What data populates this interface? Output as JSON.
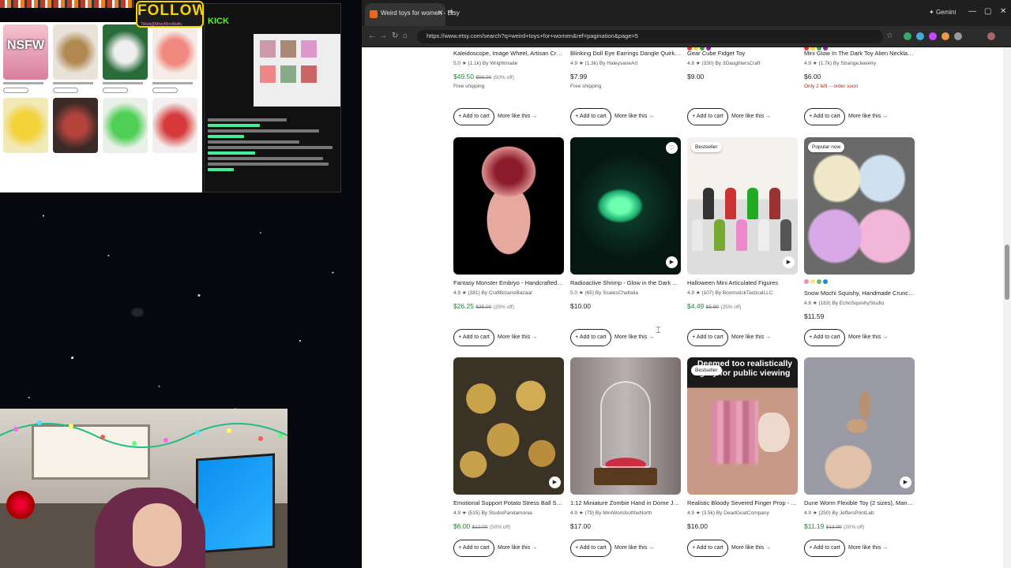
{
  "stream": {
    "follow_label": "FOLLOW",
    "follow_sub": "Tiktok@MitzyMonWaifu",
    "kick_label": "KICK",
    "nsfw_label": "NSFW"
  },
  "browser": {
    "tab_title": "Weird toys for women - Etsy",
    "gemini_label": "Gemini",
    "url": "https://www.etsy.com/search?q=weird+toys+for+women&ref=pagination&page=5"
  },
  "common": {
    "add_to_cart": "+ Add to cart",
    "more_like_this": "More like this →"
  },
  "row0": [
    {
      "title": "Kaleidoscope, Image Wheel, Artisan Crafted i...",
      "rating": "5.0 ★ (1.1k) By Wrightmade",
      "price": "$49.50",
      "orig": "$99.00",
      "pct": "(50% off)",
      "note": "Free shipping",
      "sale": true
    },
    {
      "title": "Blinking Doll Eye Earrings Dangle Quirky Weird...",
      "rating": "4.9 ★ (1.3k) By HaleysaneArt",
      "price": "$7.99",
      "orig": "",
      "pct": "",
      "note": "Free shipping",
      "sale": false
    },
    {
      "title": "Gear Cube Fidget Toy",
      "rating": "4.8 ★ (330) By 3DaughtersCraft",
      "price": "$9.00",
      "orig": "",
      "pct": "",
      "note": "",
      "sale": false
    },
    {
      "title": "Mini Glow In The Dark Toy Alien Necklaces",
      "rating": "4.9 ★ (1.7k) By StrangeJewelry",
      "price": "$6.00",
      "orig": "",
      "pct": "",
      "note": "Only 2 left -- order soon",
      "sale": false
    }
  ],
  "row1": [
    {
      "title": "Fantasy Monster Embryo - Handcrafted Clay S...",
      "rating": "4.9 ★ (381) By CraftBizarreBazaar",
      "price": "$26.25",
      "orig": "$35.00",
      "pct": "(25% off)",
      "badge": "",
      "sale": true
    },
    {
      "title": "Radioactive Shrimp - Glow in the Dark Articula...",
      "rating": "5.0 ★ (65) By ScalesChaltalia",
      "price": "$10.00",
      "orig": "",
      "pct": "",
      "badge": "",
      "sale": false
    },
    {
      "title": "Halloween Mini Articulated Figures",
      "rating": "4.9 ★ (107) By BoomstickTacticalLLC",
      "price": "$4.49",
      "orig": "$5.99",
      "pct": "(25% off)",
      "badge": "Bestseller",
      "sale": true
    },
    {
      "title": "Snow Mochi Squishy, Handmade Crunchy San...",
      "rating": "4.8 ★ (163) By EchoSquishyStudio",
      "price": "$11.59",
      "orig": "",
      "pct": "",
      "badge": "Popular now",
      "sale": false
    }
  ],
  "row2": [
    {
      "title": "Emotional Support Potato Stress Ball Squishy ...",
      "rating": "4.9 ★ (515) By StudioPandamonia",
      "price": "$6.00",
      "orig": "$12.00",
      "pct": "(50% off)",
      "badge": "",
      "sale": true
    },
    {
      "title": "1:12 Miniature Zombie Hand in Dome Jar- diora...",
      "rating": "4.9 ★ (79) By MiniWorldsoftheNorth",
      "price": "$17.00",
      "orig": "",
      "pct": "",
      "badge": "",
      "sale": false
    },
    {
      "title": "Realistic Bloody Severed Finger Prop - Hallow...",
      "rating": "4.9 ★ (3.5k) By DeadGoatCompany",
      "price": "$16.00",
      "orig": "",
      "pct": "",
      "badge": "Bestseller",
      "sale": false
    },
    {
      "title": "Dune Worm Flexible Toy (2 sizes), Many Color...",
      "rating": "4.9 ★ (250) By JeffersPrintLab",
      "price": "$11.19",
      "orig": "$13.99",
      "pct": "(20% off)",
      "badge": "",
      "sale": true
    }
  ],
  "censor_text": "Deemed too realistically gory for public viewing",
  "colors": {
    "etsy_orange": "#f1641e",
    "sale_green": "#258635"
  },
  "icons": [
    "back-icon",
    "forward-icon",
    "reload-icon",
    "home-icon",
    "bookmark-star-icon",
    "heart-icon",
    "play-icon",
    "minimize-icon",
    "maximize-icon",
    "close-icon"
  ]
}
